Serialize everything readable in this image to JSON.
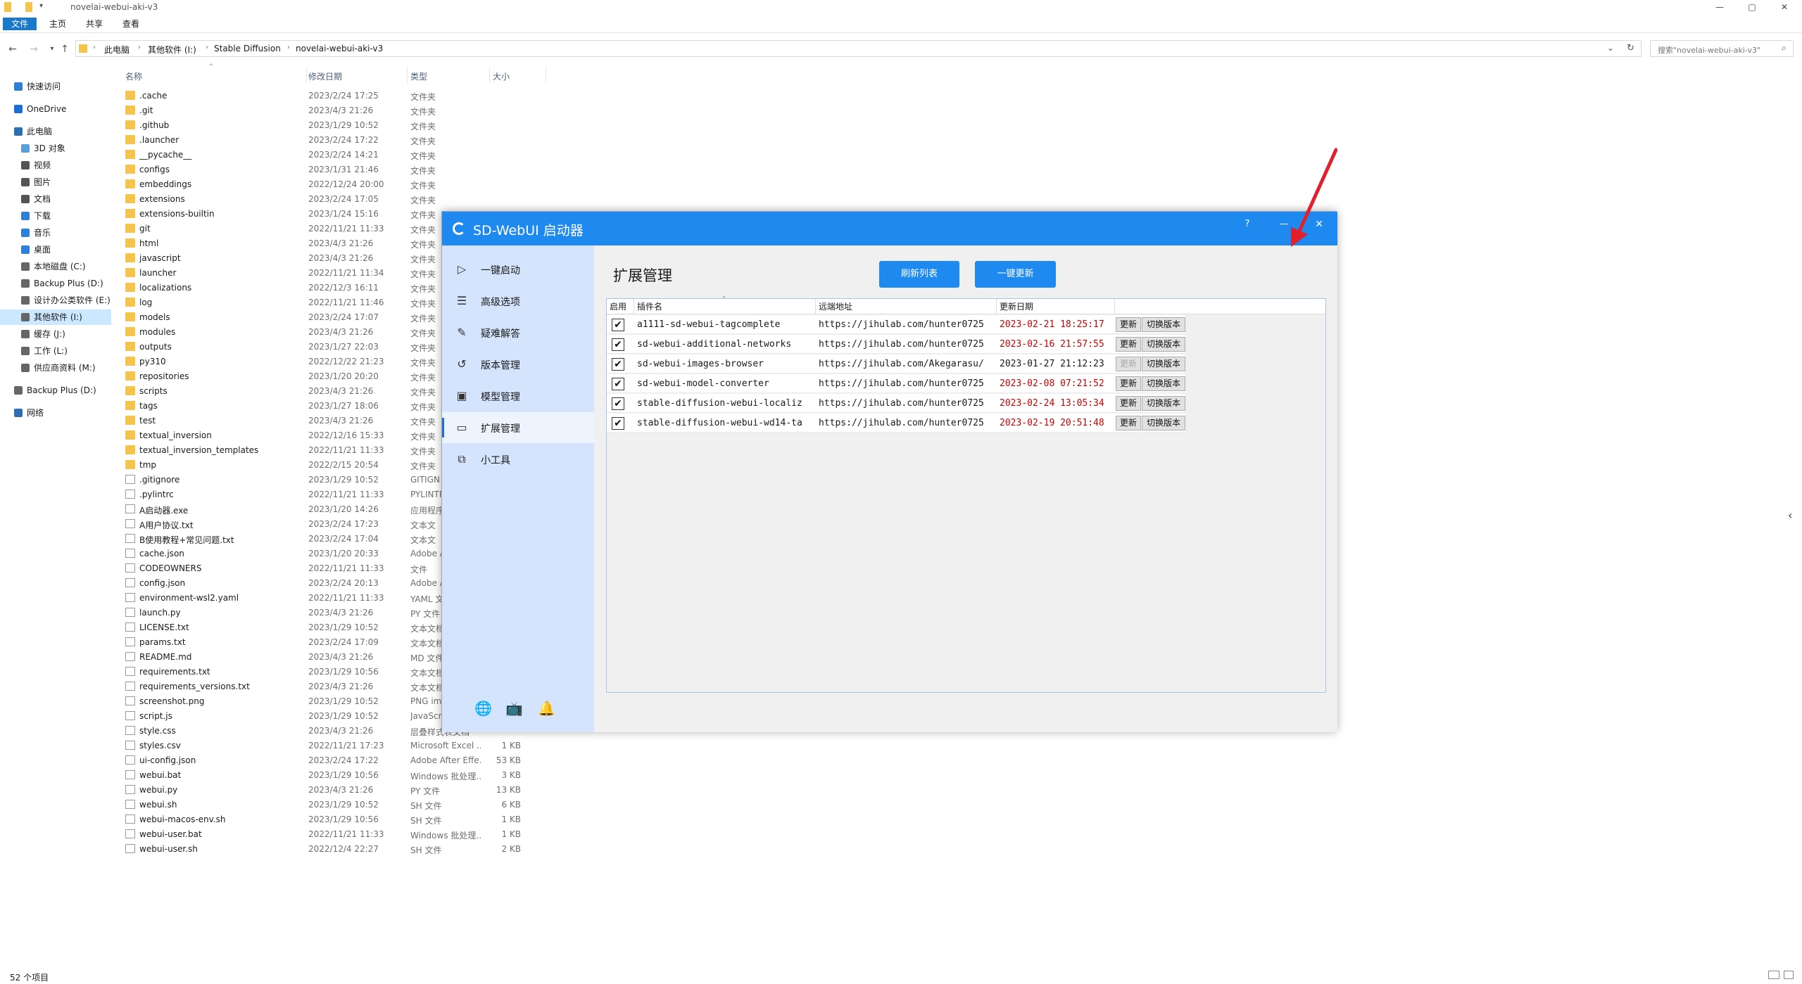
{
  "window": {
    "title": "novelai-webui-aki-v3",
    "controls": {
      "minimize": "—",
      "maximize": "▢",
      "close": "✕"
    }
  },
  "ribbon": {
    "tabs": [
      "文件",
      "主页",
      "共享",
      "查看"
    ]
  },
  "address": {
    "crumbs": [
      "此电脑",
      "其他软件 (I:)",
      "Stable Diffusion",
      "novelai-webui-aki-v3"
    ],
    "search_placeholder": "搜索\"novelai-webui-aki-v3\""
  },
  "nav_pane": {
    "items": [
      {
        "label": "快速访问",
        "icon": "star-icon",
        "color": "#2d7fd8"
      },
      {
        "label": "OneDrive",
        "icon": "cloud-icon",
        "color": "#1e6ed8"
      },
      {
        "label": "此电脑",
        "icon": "pc-icon",
        "color": "#2d6fb2"
      },
      {
        "label": "3D 对象",
        "icon": "cube-icon",
        "color": "#5aa0d8"
      },
      {
        "label": "视频",
        "icon": "video-icon",
        "color": "#555555"
      },
      {
        "label": "图片",
        "icon": "picture-icon",
        "color": "#555555"
      },
      {
        "label": "文档",
        "icon": "document-icon",
        "color": "#555555"
      },
      {
        "label": "下载",
        "icon": "download-icon",
        "color": "#2d7fd8"
      },
      {
        "label": "音乐",
        "icon": "music-icon",
        "color": "#2d7fd8"
      },
      {
        "label": "桌面",
        "icon": "desktop-icon",
        "color": "#2d7fd8"
      },
      {
        "label": "本地磁盘 (C:)",
        "icon": "drive-icon",
        "color": "#666666"
      },
      {
        "label": "Backup Plus (D:)",
        "icon": "drive-icon",
        "color": "#666666"
      },
      {
        "label": "设计办公类软件 (E:)",
        "icon": "drive-icon",
        "color": "#666666"
      },
      {
        "label": "其他软件 (I:)",
        "icon": "drive-icon",
        "color": "#666666"
      },
      {
        "label": "缓存 (J:)",
        "icon": "drive-icon",
        "color": "#666666"
      },
      {
        "label": "工作 (L:)",
        "icon": "drive-icon",
        "color": "#666666"
      },
      {
        "label": "供应商资料 (M:)",
        "icon": "drive-icon",
        "color": "#666666"
      },
      {
        "label": "Backup Plus (D:)",
        "icon": "drive-icon",
        "color": "#666666"
      },
      {
        "label": "网络",
        "icon": "network-icon",
        "color": "#2d6fb2"
      }
    ],
    "selected": "其他软件 (I:)"
  },
  "columns": {
    "name": "名称",
    "date": "修改日期",
    "type": "类型",
    "size": "大小"
  },
  "files": [
    {
      "name": ".cache",
      "date": "2023/2/24 17:25",
      "type": "文件夹",
      "size": "",
      "folder": true
    },
    {
      "name": ".git",
      "date": "2023/4/3 21:26",
      "type": "文件夹",
      "size": "",
      "folder": true
    },
    {
      "name": ".github",
      "date": "2023/1/29 10:52",
      "type": "文件夹",
      "size": "",
      "folder": true
    },
    {
      "name": ".launcher",
      "date": "2023/2/24 17:22",
      "type": "文件夹",
      "size": "",
      "folder": true
    },
    {
      "name": "__pycache__",
      "date": "2023/2/24 14:21",
      "type": "文件夹",
      "size": "",
      "folder": true
    },
    {
      "name": "configs",
      "date": "2023/1/31 21:46",
      "type": "文件夹",
      "size": "",
      "folder": true
    },
    {
      "name": "embeddings",
      "date": "2022/12/24 20:00",
      "type": "文件夹",
      "size": "",
      "folder": true
    },
    {
      "name": "extensions",
      "date": "2023/2/24 17:05",
      "type": "文件夹",
      "size": "",
      "folder": true
    },
    {
      "name": "extensions-builtin",
      "date": "2023/1/24 15:16",
      "type": "文件夹",
      "size": "",
      "folder": true
    },
    {
      "name": "git",
      "date": "2022/11/21 11:33",
      "type": "文件夹",
      "size": "",
      "folder": true
    },
    {
      "name": "html",
      "date": "2023/4/3 21:26",
      "type": "文件夹",
      "size": "",
      "folder": true
    },
    {
      "name": "javascript",
      "date": "2023/4/3 21:26",
      "type": "文件夹",
      "size": "",
      "folder": true
    },
    {
      "name": "launcher",
      "date": "2022/11/21 11:34",
      "type": "文件夹",
      "size": "",
      "folder": true
    },
    {
      "name": "localizations",
      "date": "2022/12/3 16:11",
      "type": "文件夹",
      "size": "",
      "folder": true
    },
    {
      "name": "log",
      "date": "2022/11/21 11:46",
      "type": "文件夹",
      "size": "",
      "folder": true
    },
    {
      "name": "models",
      "date": "2023/2/24 17:07",
      "type": "文件夹",
      "size": "",
      "folder": true
    },
    {
      "name": "modules",
      "date": "2023/4/3 21:26",
      "type": "文件夹",
      "size": "",
      "folder": true
    },
    {
      "name": "outputs",
      "date": "2023/1/27 22:03",
      "type": "文件夹",
      "size": "",
      "folder": true
    },
    {
      "name": "py310",
      "date": "2022/12/22 21:23",
      "type": "文件夹",
      "size": "",
      "folder": true
    },
    {
      "name": "repositories",
      "date": "2023/1/20 20:20",
      "type": "文件夹",
      "size": "",
      "folder": true
    },
    {
      "name": "scripts",
      "date": "2023/4/3 21:26",
      "type": "文件夹",
      "size": "",
      "folder": true
    },
    {
      "name": "tags",
      "date": "2023/1/27 18:06",
      "type": "文件夹",
      "size": "",
      "folder": true
    },
    {
      "name": "test",
      "date": "2023/4/3 21:26",
      "type": "文件夹",
      "size": "",
      "folder": true
    },
    {
      "name": "textual_inversion",
      "date": "2022/12/16 15:33",
      "type": "文件夹",
      "size": "",
      "folder": true
    },
    {
      "name": "textual_inversion_templates",
      "date": "2022/11/21 11:33",
      "type": "文件夹",
      "size": "",
      "folder": true
    },
    {
      "name": "tmp",
      "date": "2022/2/15 20:54",
      "type": "文件夹",
      "size": "",
      "folder": true
    },
    {
      "name": ".gitignore",
      "date": "2023/1/29 10:52",
      "type": "GITIGN",
      "size": "",
      "folder": false
    },
    {
      "name": ".pylintrc",
      "date": "2022/11/21 11:33",
      "type": "PYLINTR",
      "size": "",
      "folder": false
    },
    {
      "name": "A启动器.exe",
      "date": "2023/1/20 14:26",
      "type": "应用程序",
      "size": "",
      "folder": false
    },
    {
      "name": "A用户协议.txt",
      "date": "2023/2/24 17:23",
      "type": "文本文",
      "size": "",
      "folder": false
    },
    {
      "name": "B使用教程+常见问题.txt",
      "date": "2023/2/24 17:04",
      "type": "文本文",
      "size": "",
      "folder": false
    },
    {
      "name": "cache.json",
      "date": "2023/1/20 20:33",
      "type": "Adobe A",
      "size": "",
      "folder": false
    },
    {
      "name": "CODEOWNERS",
      "date": "2022/11/21 11:33",
      "type": "文件",
      "size": "",
      "folder": false
    },
    {
      "name": "config.json",
      "date": "2023/2/24 20:13",
      "type": "Adobe A",
      "size": "",
      "folder": false
    },
    {
      "name": "environment-wsl2.yaml",
      "date": "2022/11/21 11:33",
      "type": "YAML 文",
      "size": "",
      "folder": false
    },
    {
      "name": "launch.py",
      "date": "2023/4/3 21:26",
      "type": "PY 文件",
      "size": "",
      "folder": false
    },
    {
      "name": "LICENSE.txt",
      "date": "2023/1/29 10:52",
      "type": "文本文档",
      "size": "",
      "folder": false
    },
    {
      "name": "params.txt",
      "date": "2023/2/24 17:09",
      "type": "文本文档",
      "size": "",
      "folder": false
    },
    {
      "name": "README.md",
      "date": "2023/4/3 21:26",
      "type": "MD 文件",
      "size": "",
      "folder": false
    },
    {
      "name": "requirements.txt",
      "date": "2023/1/29 10:56",
      "type": "文本文档",
      "size": "",
      "folder": false
    },
    {
      "name": "requirements_versions.txt",
      "date": "2023/4/3 21:26",
      "type": "文本文档",
      "size": "",
      "folder": false
    },
    {
      "name": "screenshot.png",
      "date": "2023/1/29 10:52",
      "type": "PNG ima",
      "size": "",
      "folder": false
    },
    {
      "name": "script.js",
      "date": "2023/1/29 10:52",
      "type": "JavaScri",
      "size": "",
      "folder": false
    },
    {
      "name": "style.css",
      "date": "2023/4/3 21:26",
      "type": "层叠样式表文档",
      "size": "",
      "folder": false
    },
    {
      "name": "styles.csv",
      "date": "2022/11/21 17:23",
      "type": "Microsoft Excel ...",
      "size": "1 KB",
      "folder": false
    },
    {
      "name": "ui-config.json",
      "date": "2023/2/24 17:22",
      "type": "Adobe After Effe...",
      "size": "53 KB",
      "folder": false
    },
    {
      "name": "webui.bat",
      "date": "2023/1/29 10:56",
      "type": "Windows 批处理...",
      "size": "3 KB",
      "folder": false
    },
    {
      "name": "webui.py",
      "date": "2023/4/3 21:26",
      "type": "PY 文件",
      "size": "13 KB",
      "folder": false
    },
    {
      "name": "webui.sh",
      "date": "2023/1/29 10:52",
      "type": "SH 文件",
      "size": "6 KB",
      "folder": false
    },
    {
      "name": "webui-macos-env.sh",
      "date": "2023/1/29 10:56",
      "type": "SH 文件",
      "size": "1 KB",
      "folder": false
    },
    {
      "name": "webui-user.bat",
      "date": "2022/11/21 11:33",
      "type": "Windows 批处理...",
      "size": "1 KB",
      "folder": false
    },
    {
      "name": "webui-user.sh",
      "date": "2022/12/4 22:27",
      "type": "SH 文件",
      "size": "2 KB",
      "folder": false
    }
  ],
  "status": {
    "count": "52 个项目"
  },
  "launcher": {
    "title": "SD-WebUI 启动器",
    "header_buttons": {
      "help": "?",
      "minimize": "—",
      "close": "✕"
    },
    "sidebar": [
      {
        "label": "一键启动",
        "icon": "play-icon",
        "glyph": "▷"
      },
      {
        "label": "高级选项",
        "icon": "list-icon",
        "glyph": "☰"
      },
      {
        "label": "疑难解答",
        "icon": "wrench-icon",
        "glyph": "✎"
      },
      {
        "label": "版本管理",
        "icon": "history-icon",
        "glyph": "↺"
      },
      {
        "label": "模型管理",
        "icon": "box-icon",
        "glyph": "▣"
      },
      {
        "label": "扩展管理",
        "icon": "extension-icon",
        "glyph": "▭"
      },
      {
        "label": "小工具",
        "icon": "tools-icon",
        "glyph": "⧉"
      }
    ],
    "active_item": "扩展管理",
    "bottom_icons": [
      {
        "icon": "globe-icon",
        "glyph": "🌐"
      },
      {
        "icon": "bilibili-icon",
        "glyph": "📺"
      },
      {
        "icon": "bell-icon",
        "glyph": "🔔"
      }
    ],
    "page_title": "扩展管理",
    "refresh_button": "刷新列表",
    "update_all_button": "一键更新",
    "table": {
      "headers": [
        "启用",
        "插件名",
        "远端地址",
        "更新日期"
      ],
      "update_label": "更新",
      "switch_label": "切换版本",
      "rows": [
        {
          "enabled": true,
          "name": "a1111-sd-webui-tagcomplete",
          "url": "https://jihulab.com/hunter0725",
          "date": "2023-02-21 18:25:17",
          "has_update": true
        },
        {
          "enabled": true,
          "name": "sd-webui-additional-networks",
          "url": "https://jihulab.com/hunter0725",
          "date": "2023-02-16 21:57:55",
          "has_update": true
        },
        {
          "enabled": true,
          "name": "sd-webui-images-browser",
          "url": "https://jihulab.com/Akegarasu/",
          "date": "2023-01-27 21:12:23",
          "has_update": false
        },
        {
          "enabled": true,
          "name": "sd-webui-model-converter",
          "url": "https://jihulab.com/hunter0725",
          "date": "2023-02-08 07:21:52",
          "has_update": true
        },
        {
          "enabled": true,
          "name": "stable-diffusion-webui-localiz",
          "url": "https://jihulab.com/hunter0725",
          "date": "2023-02-24 13:05:34",
          "has_update": true
        },
        {
          "enabled": true,
          "name": "stable-diffusion-webui-wd14-ta",
          "url": "https://jihulab.com/hunter0725",
          "date": "2023-02-19 20:51:48",
          "has_update": true
        }
      ]
    }
  },
  "colors": {
    "accent": "#1e8af0",
    "sidebar": "#d4e4fc",
    "date_highlight": "#cc0000",
    "arrow": "#e0202a"
  }
}
